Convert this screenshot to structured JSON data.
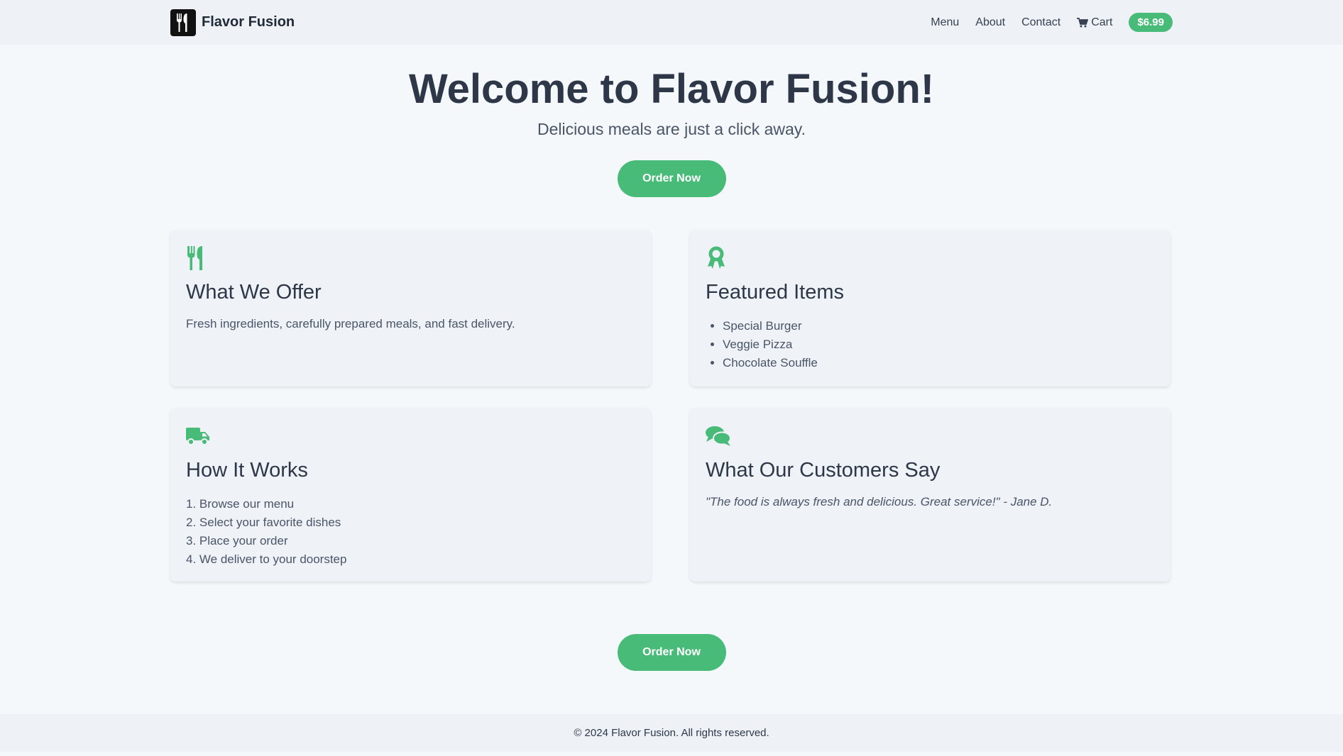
{
  "header": {
    "brand": "Flavor Fusion",
    "nav": [
      "Menu",
      "About",
      "Contact"
    ],
    "cart_label": "Cart",
    "cart_total": "$6.99"
  },
  "hero": {
    "title": "Welcome to Flavor Fusion!",
    "subtitle": "Delicious meals are just a click away.",
    "cta": "Order Now"
  },
  "cards": {
    "offer": {
      "icon": "utensils-icon",
      "title": "What We Offer",
      "text": "Fresh ingredients, carefully prepared meals, and fast delivery."
    },
    "featured": {
      "icon": "award-icon",
      "title": "Featured Items",
      "items": [
        "Special Burger",
        "Veggie Pizza",
        "Chocolate Souffle"
      ]
    },
    "how": {
      "icon": "truck-icon",
      "title": "How It Works",
      "steps": [
        "1. Browse our menu",
        "2. Select your favorite dishes",
        "3. Place your order",
        "4. We deliver to your doorstep"
      ]
    },
    "reviews": {
      "icon": "comments-icon",
      "title": "What Our Customers Say",
      "quote": "\"The food is always fresh and delicious. Great service!\" - Jane D."
    }
  },
  "bottom_cta": "Order Now",
  "footer": "© 2024 Flavor Fusion. All rights reserved.",
  "colors": {
    "accent": "#48bb78",
    "text": "#2d3748",
    "header_bg": "#eef2f7"
  }
}
